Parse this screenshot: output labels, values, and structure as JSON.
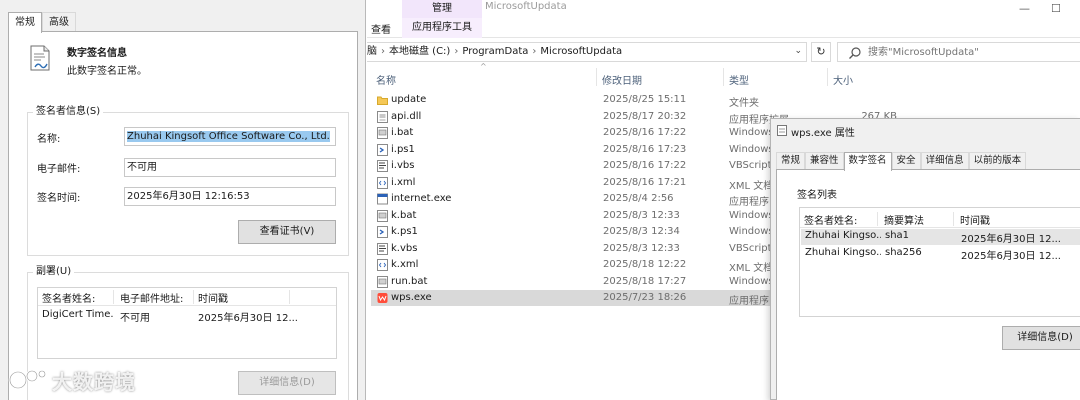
{
  "sig_dialog": {
    "tabs": [
      {
        "label": "常规"
      },
      {
        "label": "高级"
      }
    ],
    "info_title": "数字签名信息",
    "info_status": "此数字签名正常。",
    "signer_group": "签名者信息(S)",
    "name_label": "名称:",
    "name_value": "Zhuhai Kingsoft Office Software Co., Ltd.",
    "email_label": "电子邮件:",
    "email_value": "不可用",
    "time_label": "签名时间:",
    "time_value": "2025年6月30日 12:16:53",
    "view_cert_button": "查看证书(V)",
    "counter_group": "副署(U)",
    "counter_headers": [
      "签名者姓名:",
      "电子邮件地址:",
      "时间戳"
    ],
    "counter_rows": [
      {
        "name": "DigiCert Time...",
        "email": "不可用",
        "time": "2025年6月30日 12..."
      }
    ],
    "details_button": "详细信息(D)"
  },
  "watermark": {
    "text": "大数跨境"
  },
  "explorer": {
    "manage_tab": "管理",
    "app_tools_tab": "应用程序工具",
    "view_tab": "查看",
    "window_title": "MicrosoftUpdata",
    "breadcrumb": [
      "脑",
      "本地磁盘 (C:)",
      "ProgramData",
      "MicrosoftUpdata"
    ],
    "search_placeholder": "搜索\"MicrosoftUpdata\"",
    "columns": {
      "name": "名称",
      "date": "修改日期",
      "type": "类型",
      "size": "大小"
    },
    "files": [
      {
        "name": "update",
        "date": "2025/8/25 15:11",
        "type": "文件夹",
        "size": "",
        "icon": "folder-icon"
      },
      {
        "name": "api.dll",
        "date": "2025/8/17 20:32",
        "type": "应用程序扩展",
        "size": "267 KB",
        "icon": "dll-file-icon"
      },
      {
        "name": "i.bat",
        "date": "2025/8/16 17:22",
        "type": "Windows",
        "size": "",
        "icon": "bat-file-icon"
      },
      {
        "name": "i.ps1",
        "date": "2025/8/16 17:23",
        "type": "Windows",
        "size": "",
        "icon": "ps1-file-icon"
      },
      {
        "name": "i.vbs",
        "date": "2025/8/16 17:22",
        "type": "VBScript",
        "size": "",
        "icon": "vbs-file-icon"
      },
      {
        "name": "i.xml",
        "date": "2025/8/16 17:21",
        "type": "XML 文档",
        "size": "",
        "icon": "xml-file-icon"
      },
      {
        "name": "internet.exe",
        "date": "2025/8/4 2:56",
        "type": "应用程序",
        "size": "",
        "icon": "exe-file-icon"
      },
      {
        "name": "k.bat",
        "date": "2025/8/3 12:33",
        "type": "Windows",
        "size": "",
        "icon": "bat-file-icon"
      },
      {
        "name": "k.ps1",
        "date": "2025/8/3 12:34",
        "type": "Windows",
        "size": "",
        "icon": "ps1-file-icon"
      },
      {
        "name": "k.vbs",
        "date": "2025/8/3 12:33",
        "type": "VBScript",
        "size": "",
        "icon": "vbs-file-icon"
      },
      {
        "name": "k.xml",
        "date": "2025/8/18 12:22",
        "type": "XML 文档",
        "size": "",
        "icon": "xml-file-icon"
      },
      {
        "name": "run.bat",
        "date": "2025/8/18 17:27",
        "type": "Windows",
        "size": "",
        "icon": "bat-file-icon"
      },
      {
        "name": "wps.exe",
        "date": "2025/7/23 18:26",
        "type": "应用程序",
        "size": "",
        "icon": "wps-exe-icon"
      }
    ]
  },
  "props": {
    "title": "wps.exe 属性",
    "tabs": [
      {
        "label": "常规"
      },
      {
        "label": "兼容性"
      },
      {
        "label": "数字签名"
      },
      {
        "label": "安全"
      },
      {
        "label": "详细信息"
      },
      {
        "label": "以前的版本"
      }
    ],
    "list_label": "签名列表",
    "headers": [
      "签名者姓名:",
      "摘要算法",
      "时间戳"
    ],
    "rows": [
      {
        "name": "Zhuhai Kingso...",
        "algo": "sha1",
        "time": "2025年6月30日 12..."
      },
      {
        "name": "Zhuhai Kingso...",
        "algo": "sha256",
        "time": "2025年6月30日 12..."
      }
    ],
    "details_button": "详细信息(D)"
  },
  "colors": {
    "selection": "#99c9ef",
    "manage_tab": "#f2e6fb",
    "selected_row": "#d9d9d9"
  }
}
